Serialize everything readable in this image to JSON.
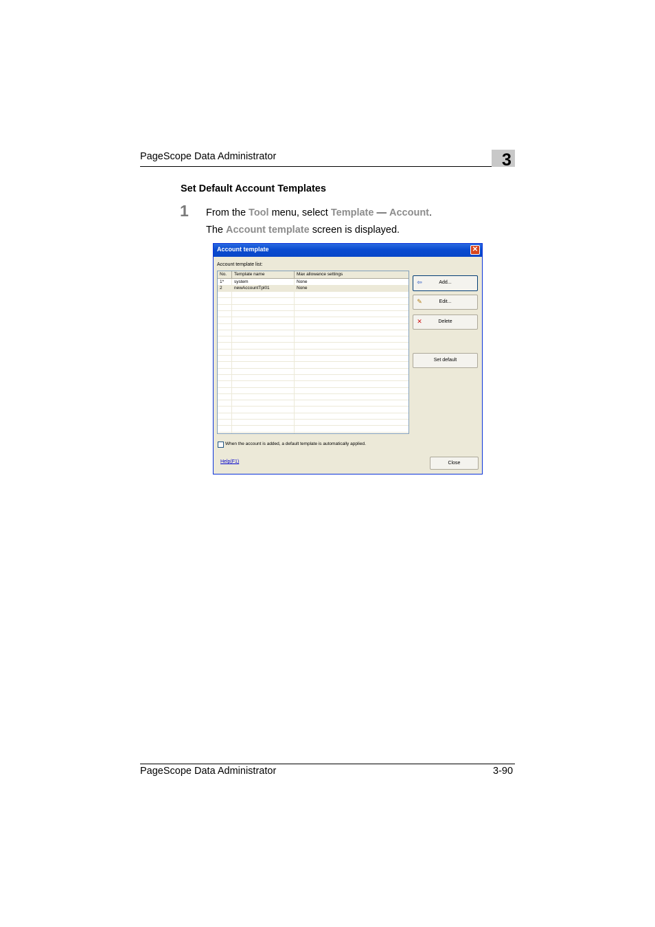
{
  "header": {
    "title": "PageScope Data Administrator",
    "chapter": "3"
  },
  "section": {
    "title": "Set Default Account Templates"
  },
  "step": {
    "number": "1",
    "text_prefix": "From the ",
    "menu": "Tool",
    "text_mid": " menu, select ",
    "item1": "Template",
    "dash": " — ",
    "item2": "Account",
    "text_end": ".",
    "result_prefix": "The ",
    "result_hl": "Account template",
    "result_suffix": " screen is displayed."
  },
  "dialog": {
    "title": "Account template",
    "close_glyph": "✕",
    "list_label": "Account template list:",
    "columns": [
      "No.",
      "Template name",
      "Max allowance settings"
    ],
    "rows": [
      {
        "no": "1*",
        "name": "system",
        "max": "None"
      },
      {
        "no": "2",
        "name": "newAccountTpl01",
        "max": "None"
      }
    ],
    "buttons": {
      "add": "Add...",
      "edit": "Edit...",
      "delete": "Delete",
      "set_default": "Set default",
      "close": "Close"
    },
    "icons": {
      "add": "add-icon",
      "edit": "edit-icon",
      "delete": "delete-icon"
    },
    "checkbox_label": "When the account is added, a default template is automatically applied.",
    "help": "Help(F1)"
  },
  "footer": {
    "title": "PageScope Data Administrator",
    "page": "3-90"
  }
}
